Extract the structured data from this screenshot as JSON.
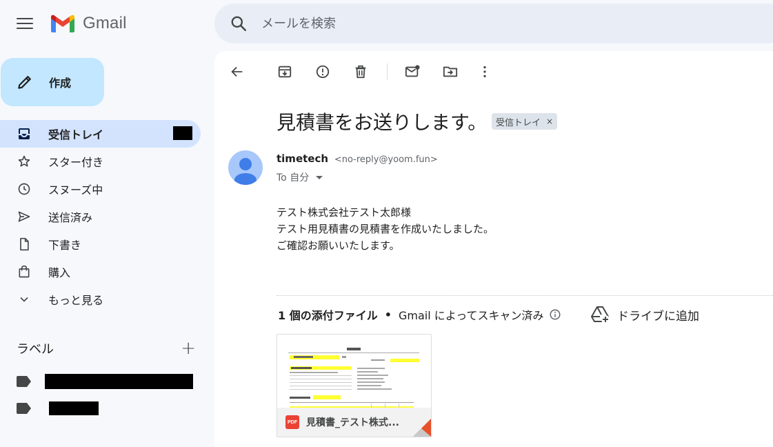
{
  "header": {
    "app_name": "Gmail",
    "search_placeholder": "メールを検索"
  },
  "compose": {
    "label": "作成"
  },
  "nav": {
    "items": [
      {
        "label": "受信トレイ",
        "icon": "inbox-icon",
        "active": true
      },
      {
        "label": "スター付き",
        "icon": "star-icon"
      },
      {
        "label": "スヌーズ中",
        "icon": "clock-icon"
      },
      {
        "label": "送信済み",
        "icon": "send-icon"
      },
      {
        "label": "下書き",
        "icon": "draft-icon"
      },
      {
        "label": "購入",
        "icon": "shopping-bag-icon"
      },
      {
        "label": "もっと見る",
        "icon": "chevron-down-icon"
      }
    ]
  },
  "labels": {
    "title": "ラベル"
  },
  "email": {
    "subject": "見積書をお送りします。",
    "badge": "受信トレイ",
    "badge_close": "×",
    "sender_name": "timetech",
    "sender_addr": "<no-reply@yoom.fun>",
    "to": "To 自分",
    "body": [
      "テスト株式会社テスト太郎様",
      "テスト用見積書の見積書を作成いたしました。",
      "ご確認お願いいたします。"
    ]
  },
  "attachments": {
    "count_label": "1 個の添付ファイル",
    "separator": "•",
    "scan_label": "Gmail によってスキャン済み",
    "drive_label": "ドライブに追加",
    "file_name": "見積書_テスト株式...",
    "file_type": "PDF"
  },
  "colors": {
    "compose_bg": "#c2e7ff",
    "active_nav": "#d3e3fd",
    "search_bg": "#e9eef6",
    "pdf_red": "#ea4335"
  }
}
